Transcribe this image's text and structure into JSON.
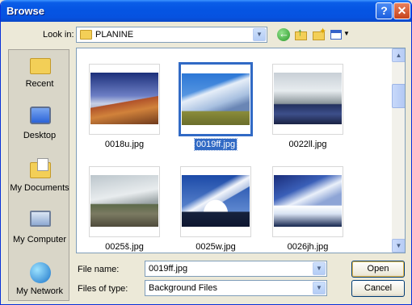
{
  "window": {
    "title": "Browse",
    "help_glyph": "?",
    "close_glyph": "✕"
  },
  "look_in": {
    "label": "Look in:",
    "value": "PLANINE",
    "toolbar_icons": [
      "back-icon",
      "up-folder-icon",
      "new-folder-icon",
      "views-menu-icon"
    ]
  },
  "places": [
    {
      "label": "Recent",
      "icon": "recent-folder-icon"
    },
    {
      "label": "Desktop",
      "icon": "desktop-icon"
    },
    {
      "label": "My Documents",
      "icon": "my-documents-icon"
    },
    {
      "label": "My Computer",
      "icon": "my-computer-icon"
    },
    {
      "label": "My Network",
      "icon": "my-network-icon"
    }
  ],
  "files": [
    {
      "name": "0018u.jpg",
      "selected": false
    },
    {
      "name": "0019ff.jpg",
      "selected": true
    },
    {
      "name": "0022ll.jpg",
      "selected": false
    },
    {
      "name": "0025š.jpg",
      "selected": false
    },
    {
      "name": "0025w.jpg",
      "selected": false
    },
    {
      "name": "0026jh.jpg",
      "selected": false
    }
  ],
  "file_name": {
    "label": "File name:",
    "value": "0019ff.jpg"
  },
  "file_type": {
    "label": "Files of type:",
    "value": "Background Files"
  },
  "buttons": {
    "open": "Open",
    "cancel": "Cancel"
  }
}
